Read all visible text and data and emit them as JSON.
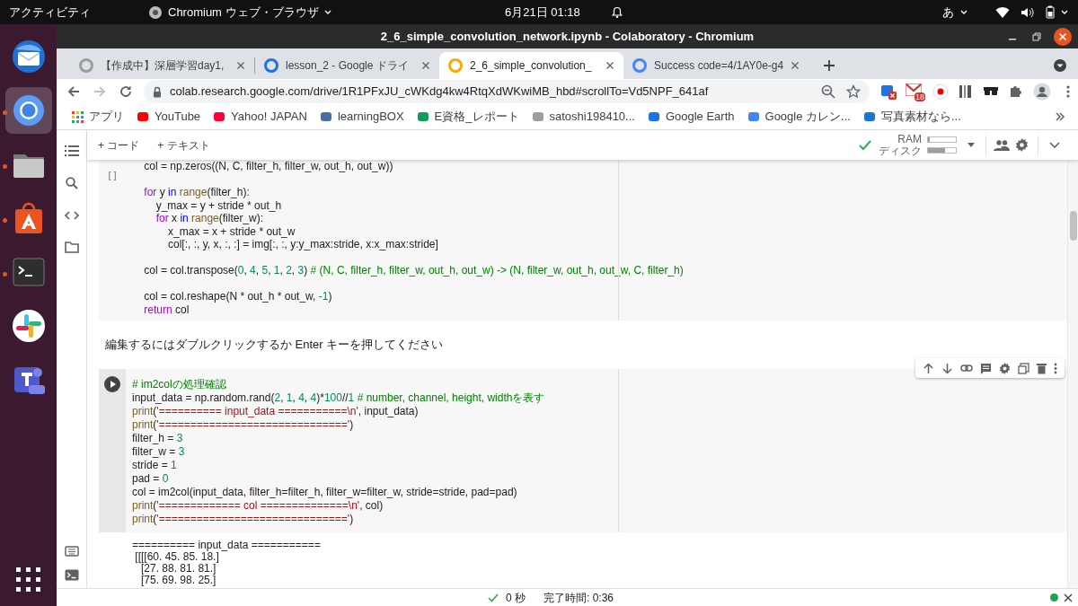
{
  "topbar": {
    "activities": "アクティビティ",
    "app_menu": "Chromium ウェブ・ブラウザ",
    "datetime": "6月21日 01:18",
    "input_method": "あ"
  },
  "dock": [
    {
      "kind": "mail",
      "running": false,
      "selected": false
    },
    {
      "kind": "browser",
      "running": true,
      "selected": true
    },
    {
      "kind": "files",
      "running": true,
      "selected": false
    },
    {
      "kind": "store",
      "running": true,
      "selected": false
    },
    {
      "kind": "terminal",
      "running": true,
      "selected": false
    },
    {
      "kind": "chat",
      "running": false,
      "selected": false
    },
    {
      "kind": "teams",
      "running": false,
      "selected": false
    }
  ],
  "window": {
    "title": "2_6_simple_convolution_network.ipynb - Colaboratory - Chromium"
  },
  "tabs": [
    {
      "label": "【作成中】深層学習day1,",
      "selected": false,
      "color": "#9e9e9e"
    },
    {
      "label": "lesson_2 - Google ドライ",
      "selected": false,
      "color": "#1a73e8"
    },
    {
      "label": "2_6_simple_convolution_",
      "selected": true,
      "color": "#f9ab00"
    },
    {
      "label": "Success code=4/1AY0e-g4",
      "selected": false,
      "color": "#4285f4"
    }
  ],
  "address_bar": {
    "url": "colab.research.google.com/drive/1R1PFxJU_cWKdg4kw4RtqXdWKwiMB_hbd#scrollTo=Vd5NPF_641af",
    "mail_badge": "18"
  },
  "bookmarks": [
    {
      "label": "アプリ",
      "kind": "apps"
    },
    {
      "label": "YouTube",
      "kind": "site",
      "color": "#ff0000"
    },
    {
      "label": "Yahoo! JAPAN",
      "kind": "site",
      "color": "#ff0033"
    },
    {
      "label": "learningBOX",
      "kind": "site",
      "color": "#4a6fa5"
    },
    {
      "label": "E資格_レポート",
      "kind": "site",
      "color": "#0f9d58"
    },
    {
      "label": "satoshi198410...",
      "kind": "site",
      "color": "#9e9e9e"
    },
    {
      "label": "Google Earth",
      "kind": "site",
      "color": "#1a73e8"
    },
    {
      "label": "Google カレン...",
      "kind": "site",
      "color": "#4285f4"
    },
    {
      "label": "写真素材なら...",
      "kind": "site",
      "color": "#1976d2"
    }
  ],
  "colab": {
    "toolbar": {
      "add_code": "+ コード",
      "add_text": "+ テキスト",
      "ram_label": "RAM",
      "disk_label": "ディスク",
      "ram": {
        "level": 0.05
      },
      "disk": {
        "level": 0.6
      }
    },
    "cells": [
      {
        "kind": "code",
        "focused": false,
        "gutter": "[ ]",
        "lines": [
          {
            "kind": "code",
            "tokens": [
              "    col = np.zeros((N, C, filter_h, filter_w, out_h, out_w))"
            ]
          },
          {
            "kind": "blank"
          },
          {
            "kind": "code",
            "tokens": [
              {
                "text": "    for",
                "kind": "keyword"
              },
              "y",
              {
                "text": "in",
                "kind": "in"
              },
              {
                "text": "range",
                "kind": "builtin"
              },
              "(filter_h):"
            ]
          },
          {
            "kind": "code",
            "tokens": [
              "        y_max = y + stride * out_h"
            ]
          },
          {
            "kind": "code",
            "tokens": [
              {
                "text": "        for",
                "kind": "keyword"
              },
              "x",
              {
                "text": "in",
                "kind": "in"
              },
              {
                "text": "range",
                "kind": "builtin"
              },
              "(filter_w):"
            ]
          },
          {
            "kind": "code",
            "tokens": [
              "            x_max = x + stride * out_w"
            ]
          },
          {
            "kind": "code",
            "tokens": [
              "            col[:, :, y, x, :, :] = img[:, :, y:y_max:stride, x:x_max:stride]"
            ]
          },
          {
            "kind": "blank"
          },
          {
            "kind": "code",
            "tokens": [
              "    col = col.transpose(",
              {
                "text": "0",
                "kind": "number"
              },
              ", ",
              {
                "text": "4",
                "kind": "number"
              },
              ", ",
              {
                "text": "5",
                "kind": "number"
              },
              ", ",
              {
                "text": "1",
                "kind": "number"
              },
              ", ",
              {
                "text": "2",
                "kind": "number"
              },
              ", ",
              {
                "text": "3",
                "kind": "number"
              },
              ") ",
              {
                "text": "# (N, C, filter_h, filter_w, out_h, out_w) -> (N, filter_w, out_h, out_w, C, filter_h)",
                "kind": "comment"
              }
            ]
          },
          {
            "kind": "blank"
          },
          {
            "kind": "code",
            "tokens": [
              "    col = col.reshape(N * out_h * out_w, ",
              {
                "text": "-1",
                "kind": "number"
              },
              ")"
            ]
          },
          {
            "kind": "code",
            "tokens": [
              {
                "text": "    return",
                "kind": "keyword"
              },
              "col"
            ]
          }
        ]
      },
      {
        "kind": "code",
        "focused": true,
        "lines": [
          {
            "kind": "code",
            "tokens": [
              {
                "text": "# im2colの処理確認",
                "kind": "comment"
              }
            ]
          },
          {
            "kind": "code",
            "tokens": [
              "input_data = np.random.rand(",
              {
                "text": "2",
                "kind": "number"
              },
              ", ",
              {
                "text": "1",
                "kind": "number"
              },
              ", ",
              {
                "text": "4",
                "kind": "number"
              },
              ", ",
              {
                "text": "4",
                "kind": "number"
              },
              ")*",
              {
                "text": "100",
                "kind": "number"
              },
              "//",
              {
                "text": "1",
                "kind": "number"
              },
              {
                "text": "# number, channel, height, widthを表す",
                "kind": "comment"
              }
            ]
          },
          {
            "kind": "code",
            "tokens": [
              {
                "text": "print",
                "kind": "builtin"
              },
              "(",
              {
                "text": "'========== input_data ===========\\n'",
                "kind": "string"
              },
              ", input_data)"
            ]
          },
          {
            "kind": "code",
            "tokens": [
              {
                "text": "print",
                "kind": "builtin"
              },
              "(",
              {
                "text": "'=============================='",
                "kind": "string"
              },
              ")"
            ]
          },
          {
            "kind": "code",
            "tokens": [
              "filter_h = ",
              {
                "text": "3",
                "kind": "number"
              }
            ]
          },
          {
            "kind": "code",
            "tokens": [
              "filter_w = ",
              {
                "text": "3",
                "kind": "number"
              }
            ]
          },
          {
            "kind": "code",
            "tokens": [
              "stride = ",
              {
                "text": "1",
                "kind": "number"
              }
            ]
          },
          {
            "kind": "code",
            "tokens": [
              "pad = ",
              {
                "text": "0",
                "kind": "number"
              }
            ]
          },
          {
            "kind": "code",
            "tokens": [
              "col = im2col(input_data, filter_h=filter_h, filter_w=filter_w, stride=stride, pad=pad)"
            ]
          },
          {
            "kind": "code",
            "tokens": [
              {
                "text": "print",
                "kind": "builtin"
              },
              "(",
              {
                "text": "'============= col ==============\\n'",
                "kind": "string"
              },
              ", col)"
            ]
          },
          {
            "kind": "code",
            "tokens": [
              {
                "text": "print",
                "kind": "builtin"
              },
              "(",
              {
                "text": "'=============================='",
                "kind": "string"
              },
              ")"
            ]
          }
        ]
      }
    ],
    "hint": "編集するにはダブルクリックするか Enter キーを押してください",
    "output": [
      "========== input_data ===========",
      " [[[[60. 45. 85. 18.]",
      "   [27. 88. 81. 81.]",
      "   [75. 69. 98. 25.]"
    ],
    "status": {
      "duration": "0 秒",
      "completed": "完了時間: 0:36",
      "connected": true
    }
  }
}
